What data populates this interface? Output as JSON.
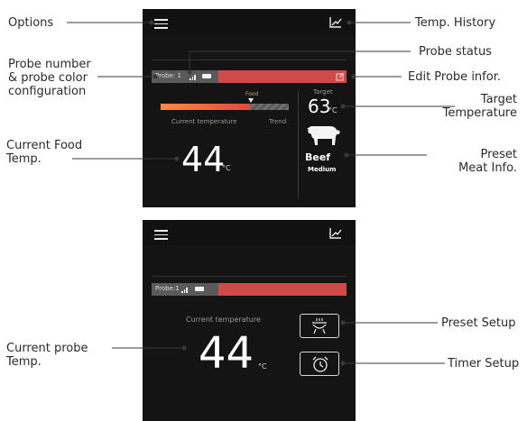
{
  "callouts": {
    "options": "Options",
    "temp_history": "Temp. History",
    "probe_status": "Probe status",
    "probe_number_l1": "Probe number",
    "probe_number_l2": "& probe color",
    "probe_number_l3": "configuration",
    "edit_probe": "Edit Probe infor.",
    "target_l1": "Target",
    "target_l2": "Temperature",
    "current_food_l1": "Current Food",
    "current_food_l2": "Temp.",
    "preset_meat_l1": "Preset",
    "preset_meat_l2": "Meat Info.",
    "preset_setup": "Preset Setup",
    "current_probe_l1": "Current probe",
    "current_probe_l2": "Temp.",
    "timer_setup": "Timer Setup"
  },
  "screen1": {
    "probe_label": "Probe: 1",
    "food_marker": "Food",
    "target_label": "Target",
    "target_value": "63",
    "target_unit": "°C",
    "current_label": "Current temperature",
    "trend_label": "Trend",
    "current_value": "44",
    "current_unit": "°C",
    "meat": "Beef",
    "doneness": "Medium"
  },
  "screen2": {
    "probe_label": "Probe:1",
    "current_label": "Current temperature",
    "current_value": "44",
    "current_unit": "°C"
  },
  "colors": {
    "probe_red": "#d24a48",
    "screen_bg": "#141414",
    "gradient_start": "#ff8a3d",
    "gradient_end": "#e04a3a"
  },
  "icons": [
    "menu-icon",
    "history-chart-icon",
    "edit-icon",
    "signal-icon",
    "battery-icon",
    "cow-icon",
    "grill-icon",
    "alarm-clock-icon"
  ]
}
